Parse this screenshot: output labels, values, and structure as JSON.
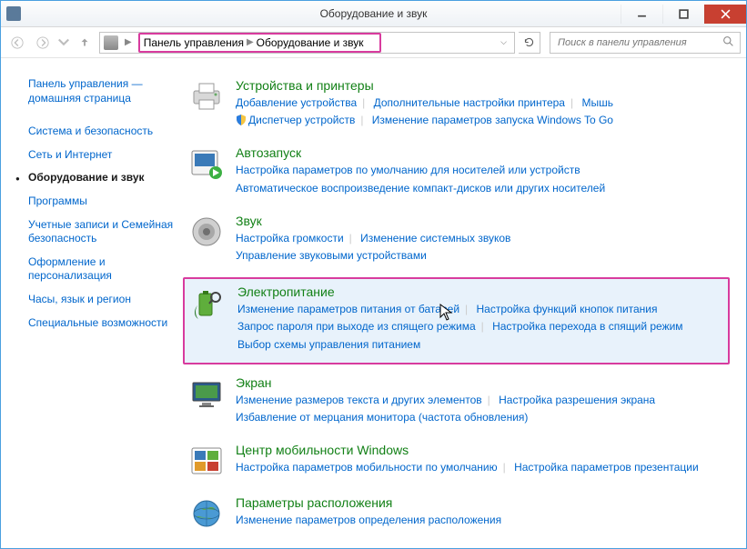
{
  "window": {
    "title": "Оборудование и звук"
  },
  "address": {
    "seg1": "Панель управления",
    "seg2": "Оборудование и звук"
  },
  "search": {
    "placeholder": "Поиск в панели управления"
  },
  "sidebar": {
    "home": "Панель управления — домашняя страница",
    "items": [
      "Система и безопасность",
      "Сеть и Интернет",
      "Оборудование и звук",
      "Программы",
      "Учетные записи и Семейная безопасность",
      "Оформление и персонализация",
      "Часы, язык и регион",
      "Специальные возможности"
    ]
  },
  "categories": [
    {
      "title": "Устройства и принтеры",
      "links": [
        "Добавление устройства",
        "Дополнительные настройки принтера",
        "Мышь",
        "Диспетчер устройств",
        "Изменение параметров запуска Windows To Go"
      ],
      "shield_at": 3
    },
    {
      "title": "Автозапуск",
      "links": [
        "Настройка параметров по умолчанию для носителей или устройств",
        "Автоматическое воспроизведение компакт-дисков или других носителей"
      ]
    },
    {
      "title": "Звук",
      "links": [
        "Настройка громкости",
        "Изменение системных звуков",
        "Управление звуковыми устройствами"
      ]
    },
    {
      "title": "Электропитание",
      "links": [
        "Изменение параметров питания от батарей",
        "Настройка функций кнопок питания",
        "Запрос пароля при выходе из спящего режима",
        "Настройка перехода в спящий режим",
        "Выбор схемы управления питанием"
      ]
    },
    {
      "title": "Экран",
      "links": [
        "Изменение размеров текста и других элементов",
        "Настройка разрешения экрана",
        "Избавление от мерцания монитора (частота обновления)"
      ]
    },
    {
      "title": "Центр мобильности Windows",
      "links": [
        "Настройка параметров мобильности по умолчанию",
        "Настройка параметров презентации"
      ]
    },
    {
      "title": "Параметры расположения",
      "links": [
        "Изменение параметров определения расположения"
      ]
    }
  ]
}
